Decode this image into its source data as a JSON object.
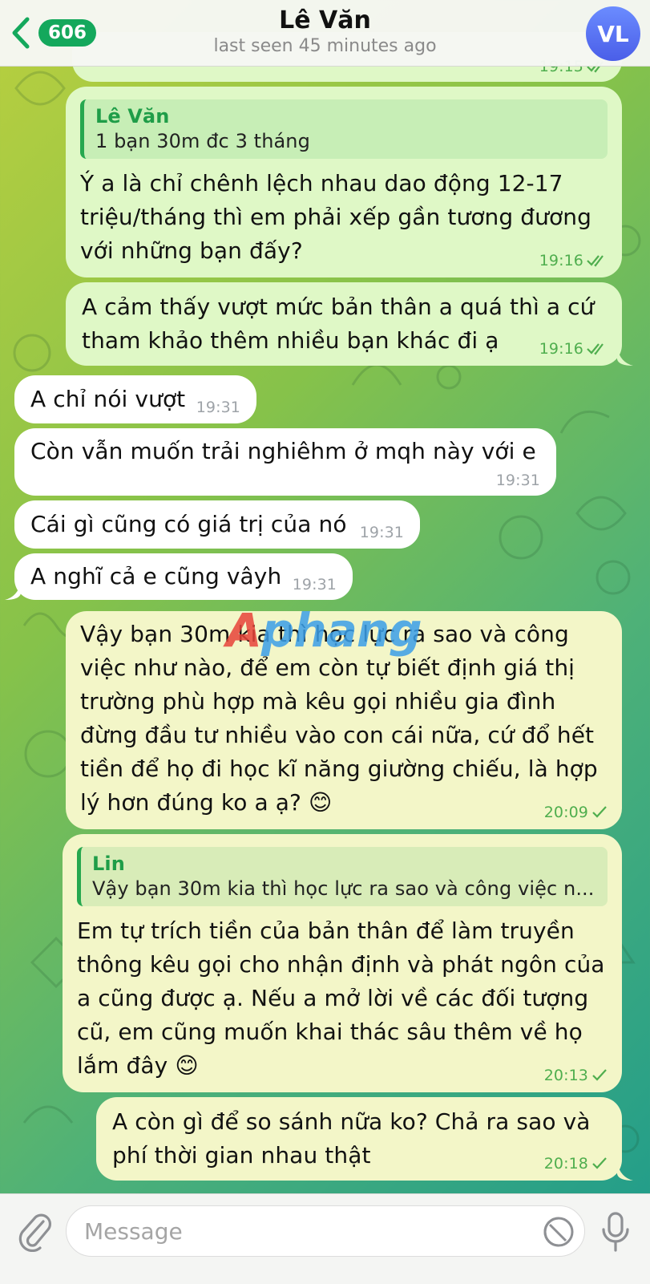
{
  "header": {
    "back_count": "606",
    "contact_name": "Lê Văn",
    "status": "last seen 45 minutes ago",
    "avatar_initials": "VL"
  },
  "messages": [
    {
      "id": "m0",
      "direction": "out",
      "text": "",
      "time": "19:15",
      "read": true
    },
    {
      "id": "m1",
      "direction": "out",
      "reply": {
        "name": "Lê Văn",
        "text": "1 bạn 30m đc 3 tháng"
      },
      "text": "Ý a là chỉ chênh lệch nhau dao động 12-17 triệu/tháng thì em phải xếp gần tương đương với những bạn đấy?",
      "time": "19:16",
      "read": true
    },
    {
      "id": "m2",
      "direction": "out",
      "text": "A cảm thấy vượt mức bản thân a quá thì a cứ tham khảo thêm nhiều bạn khác đi ạ",
      "time": "19:16",
      "read": true
    },
    {
      "id": "m3",
      "direction": "in",
      "text": "A chỉ nói vượt",
      "time": "19:31"
    },
    {
      "id": "m4",
      "direction": "in",
      "text": "Còn vẫn muốn trải nghiêhm ở mqh này với e",
      "time": "19:31"
    },
    {
      "id": "m5",
      "direction": "in",
      "text": "Cái gì cũng có giá trị của nó",
      "time": "19:31"
    },
    {
      "id": "m6",
      "direction": "in",
      "text": "A nghĩ cả e cũng vâyh",
      "time": "19:31"
    },
    {
      "id": "m7",
      "direction": "out",
      "text": "Vậy bạn 30m kia thì học lực ra sao và công việc như nào, để em còn tự biết định giá thị trường phù hợp mà kêu gọi nhiều gia đình đừng đầu tư nhiều vào con cái nữa, cứ đổ hết tiền để họ đi học kĩ năng giường chiếu, là hợp lý hơn đúng ko a ạ? 😊",
      "time": "20:09",
      "read": false
    },
    {
      "id": "m8",
      "direction": "out",
      "reply": {
        "name": "Lin",
        "text": "Vậy bạn 30m kia thì học lực ra sao và công việc n..."
      },
      "text": "Em tự trích tiền của bản thân để làm truyền thông kêu gọi cho nhận định và phát ngôn của a cũng được ạ. Nếu a mở lời về các đối tượng cũ, em cũng muốn khai thác sâu thêm về họ lắm đây 😊",
      "time": "20:13",
      "read": false
    },
    {
      "id": "m9",
      "direction": "out",
      "text": "A còn gì để so sánh nữa ko? Chả ra sao và phí thời gian nhau thật",
      "time": "20:18",
      "read": false
    }
  ],
  "watermark": {
    "first": "A",
    "rest": "phang"
  },
  "composer": {
    "placeholder": "Message"
  },
  "colors": {
    "outgoing": "#dff8c6",
    "incoming": "#ffffff",
    "accent": "#14a85c"
  }
}
